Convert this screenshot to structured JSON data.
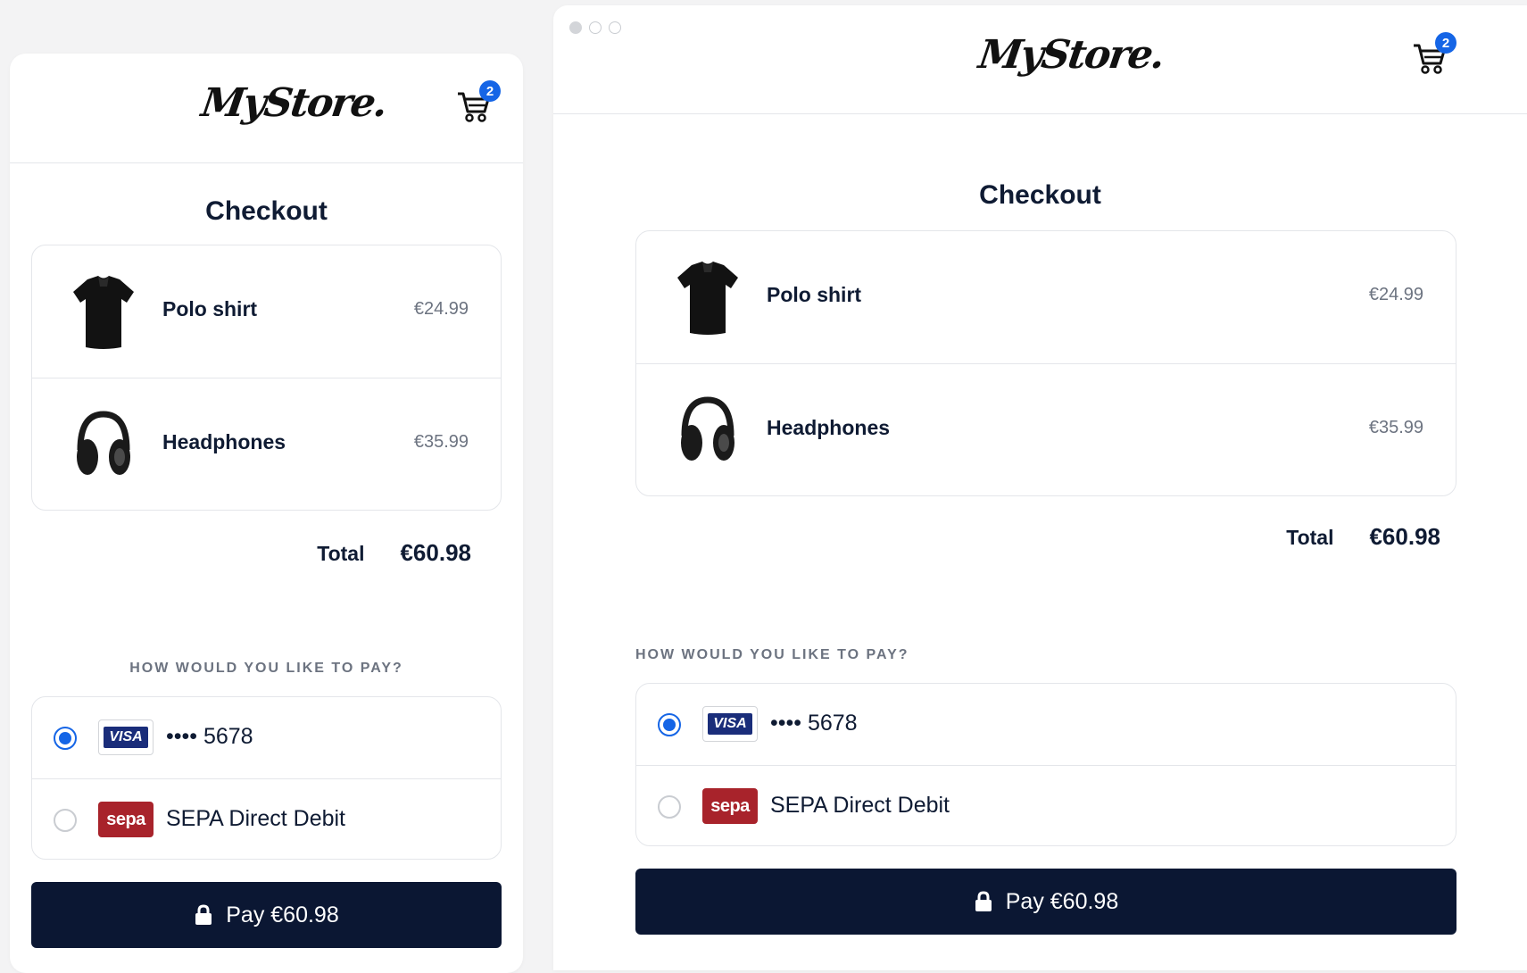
{
  "store": {
    "logo_text": "MyStore.",
    "cart_count": "2"
  },
  "checkout": {
    "title": "Checkout",
    "items": [
      {
        "name": "Polo shirt",
        "price": "€24.99",
        "icon": "polo-shirt-image"
      },
      {
        "name": "Headphones",
        "price": "€35.99",
        "icon": "headphones-image"
      }
    ],
    "total_label": "Total",
    "total_value": "€60.98"
  },
  "payment": {
    "question": "HOW WOULD YOU LIKE TO PAY?",
    "methods": [
      {
        "badge": "VISA",
        "label": "•••• 5678",
        "selected": true
      },
      {
        "badge": "sepa",
        "label": "SEPA Direct Debit",
        "selected": false
      }
    ],
    "pay_button": "Pay €60.98"
  },
  "colors": {
    "accent": "#1565e6",
    "button": "#0b1733",
    "sepa": "#a8232b",
    "visa": "#1a2d7a"
  }
}
